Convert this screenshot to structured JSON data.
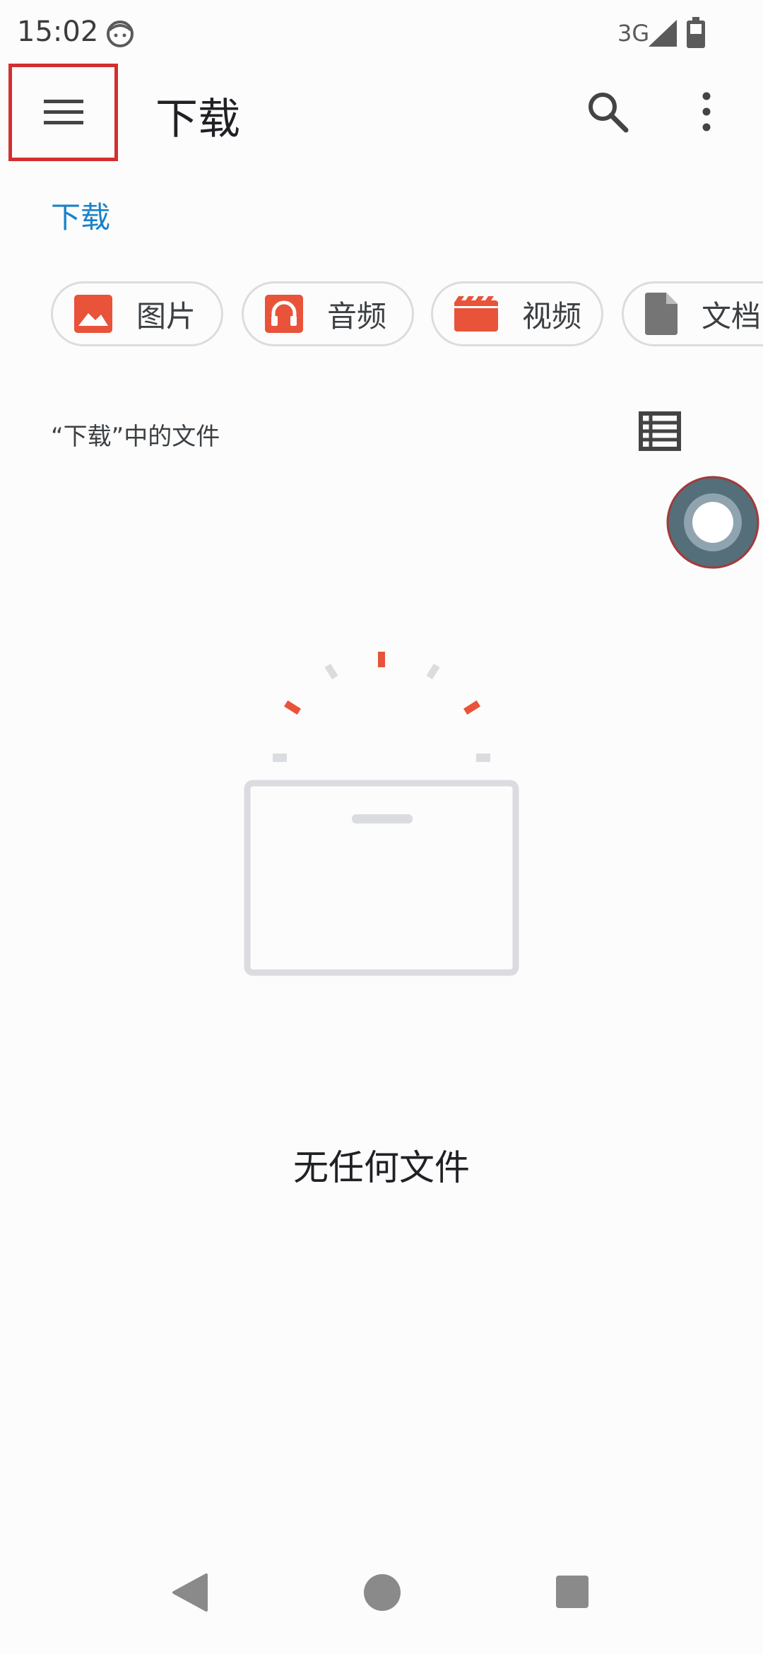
{
  "status_bar": {
    "time": "15:02",
    "network": "3G"
  },
  "app_bar": {
    "title": "下载",
    "menu_icon": "hamburger-menu-icon",
    "search_icon": "search-icon",
    "more_icon": "more-vert-icon"
  },
  "breadcrumb": {
    "current": "下载"
  },
  "categories": [
    {
      "label": "图片",
      "icon": "image-icon",
      "color": "#e8533a"
    },
    {
      "label": "音频",
      "icon": "headphones-icon",
      "color": "#e8533a"
    },
    {
      "label": "视频",
      "icon": "video-icon",
      "color": "#e8533a"
    },
    {
      "label": "文档",
      "icon": "document-icon",
      "color": "#757575"
    }
  ],
  "section": {
    "title": "“下载”中的文件",
    "view_icon": "list-view-icon"
  },
  "empty_state": {
    "message": "无任何文件"
  },
  "colors": {
    "accent": "#1a82c8",
    "highlight_box": "#d32f2f",
    "illustration_orange": "#e8533a",
    "illustration_gray": "#dadce0"
  }
}
